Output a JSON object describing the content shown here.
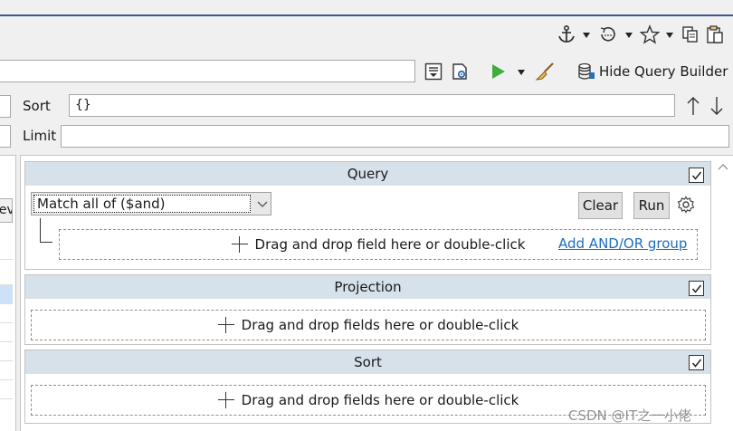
{
  "toolbar": {
    "icons": [
      "anchor-icon",
      "history-icon",
      "star-icon",
      "copy-icon",
      "paste-icon"
    ],
    "hide_query_builder_label": "Hide Query Builder"
  },
  "options": {
    "sort_label": "Sort",
    "sort_value": "{}",
    "limit_label": "Limit",
    "limit_value": ""
  },
  "left_partial": {
    "tab_fragment": "iev"
  },
  "query_panel": {
    "title": "Query",
    "match_select": "Match all of ($and)",
    "clear_label": "Clear",
    "run_label": "Run",
    "drop_hint": "Drag and drop field here or double-click",
    "add_group_link": "Add AND/OR group"
  },
  "projection_panel": {
    "title": "Projection",
    "drop_hint": "Drag and drop fields here or double-click"
  },
  "sort_panel": {
    "title": "Sort",
    "drop_hint": "Drag and drop fields here or double-click"
  },
  "watermark": "CSDN @IT之一小佬",
  "colors": {
    "panel_header": "#d6e1ea",
    "link": "#1a6ec0",
    "accent_line": "#3e5a8a",
    "run_green": "#3fae3f"
  }
}
